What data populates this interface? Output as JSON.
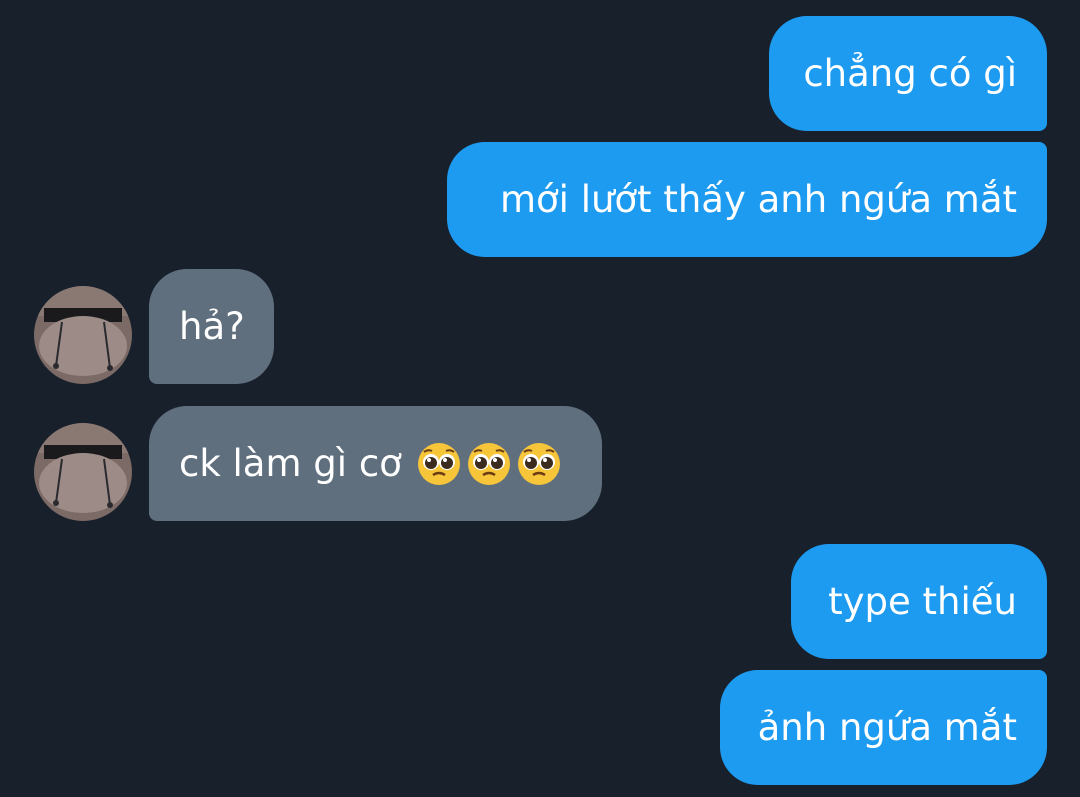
{
  "conversation": {
    "messages": [
      {
        "from": "me",
        "text": "chẳng có gì"
      },
      {
        "from": "me",
        "text": "mới lướt thấy anh ngứa mắt"
      },
      {
        "from": "them",
        "text": "hả?"
      },
      {
        "from": "them",
        "text": "ck làm gì cơ",
        "emojis": [
          "pleading-face",
          "pleading-face",
          "pleading-face"
        ]
      },
      {
        "from": "me",
        "text": "type thiếu"
      },
      {
        "from": "me",
        "text": "ảnh ngứa mắt"
      }
    ]
  },
  "colors": {
    "background": "#18202b",
    "outgoing_bubble": "#1d9bf0",
    "incoming_bubble": "#5f6f7e",
    "text": "#ffffff"
  }
}
